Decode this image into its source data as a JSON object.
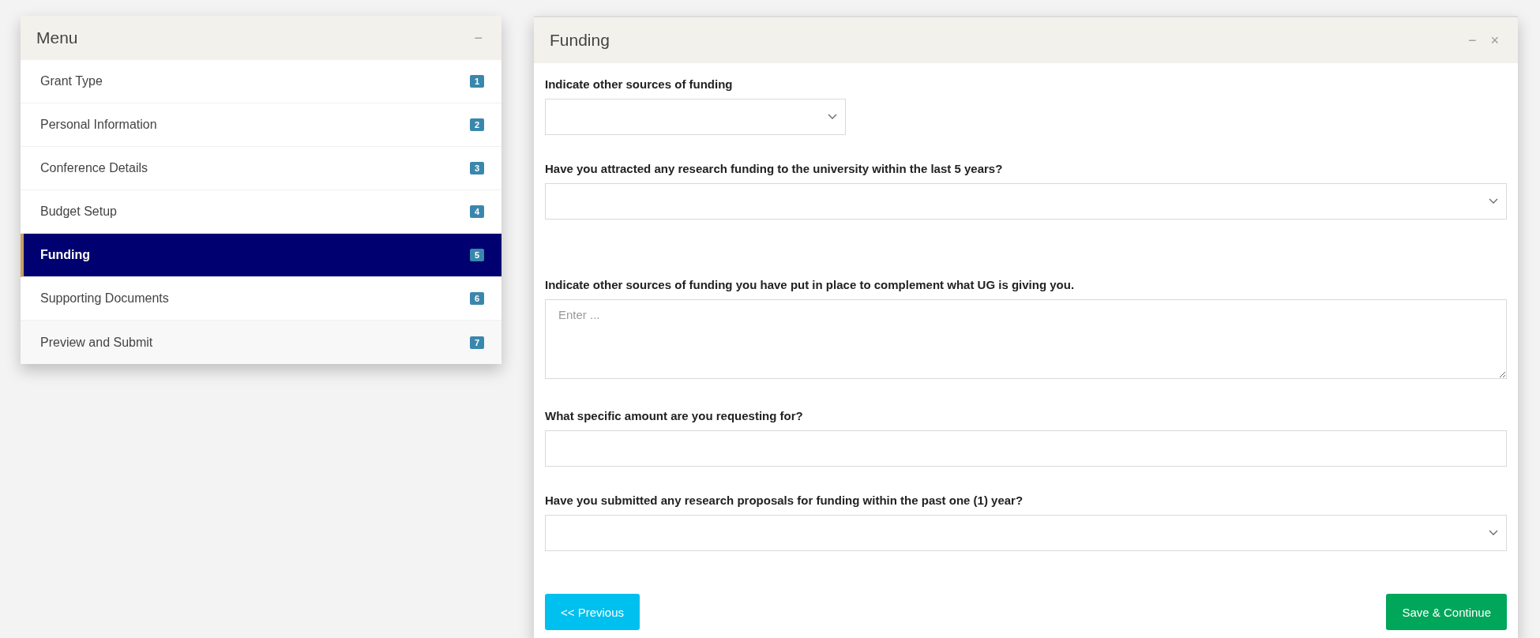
{
  "menu": {
    "title": "Menu",
    "collapse": "−",
    "items": [
      {
        "label": "Grant Type",
        "badge": "1",
        "selected": false
      },
      {
        "label": "Personal Information",
        "badge": "2",
        "selected": false
      },
      {
        "label": "Conference Details",
        "badge": "3",
        "selected": false
      },
      {
        "label": "Budget Setup",
        "badge": "4",
        "selected": false
      },
      {
        "label": "Funding",
        "badge": "5",
        "selected": true
      },
      {
        "label": "Supporting Documents",
        "badge": "6",
        "selected": false
      },
      {
        "label": "Preview and Submit",
        "badge": "7",
        "selected": false
      }
    ]
  },
  "panel": {
    "title": "Funding",
    "minimize": "−",
    "close": "×",
    "fields": [
      {
        "kind": "select",
        "label": "Indicate other sources of funding"
      },
      {
        "kind": "select",
        "label": "Have you attracted any research funding to the university within the last 5 years?"
      },
      {
        "kind": "textarea",
        "label": "Indicate other sources of funding you have put in place to complement what UG is giving you.",
        "placeholder": "Enter ..."
      },
      {
        "kind": "input",
        "label": "What specific amount are you requesting for?"
      },
      {
        "kind": "select",
        "label": "Have you submitted any research proposals for funding within the past one (1) year?"
      }
    ],
    "buttons": [
      {
        "kind": "previous",
        "label": "<< Previous"
      },
      {
        "kind": "save",
        "label": "Save & Continue"
      }
    ]
  }
}
